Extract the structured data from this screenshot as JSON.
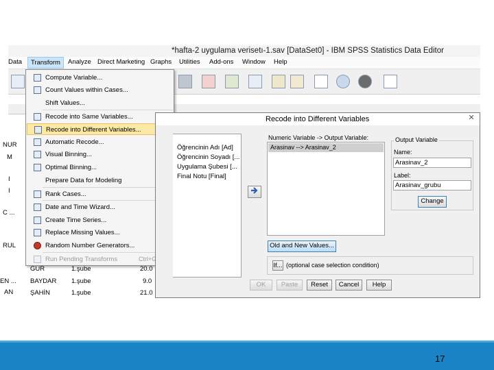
{
  "window": {
    "title": "*hafta-2 uygulama verisetı-1.sav [DataSet0] - IBM SPSS Statistics Data Editor"
  },
  "menubar": {
    "items": [
      "Data",
      "Transform",
      "Analyze",
      "Direct Marketing",
      "Graphs",
      "Utilities",
      "Add-ons",
      "Window",
      "Help"
    ]
  },
  "transform_menu": {
    "items": [
      {
        "label": "Compute Variable..."
      },
      {
        "label": "Count Values within Cases..."
      },
      {
        "label": "Shift Values..."
      },
      {
        "label": "Recode into Same Variables..."
      },
      {
        "label": "Recode into Different Variables..."
      },
      {
        "label": "Automatic Recode..."
      },
      {
        "label": "Visual Binning..."
      },
      {
        "label": "Optimal Binning..."
      },
      {
        "label": "Prepare Data for Modeling"
      },
      {
        "label": "Rank Cases..."
      },
      {
        "label": "Date and Time Wizard..."
      },
      {
        "label": "Create Time Series..."
      },
      {
        "label": "Replace Missing Values..."
      },
      {
        "label": "Random Number Generators..."
      },
      {
        "label": "Run Pending Transforms",
        "shortcut": "Ctrl+G"
      }
    ],
    "highlighted": "Recode into Different Variables..."
  },
  "grid": {
    "left_labels": [
      "NUR",
      "M",
      "I",
      "I",
      "C ...",
      "RUL",
      "EN ...",
      "AN"
    ],
    "rows": [
      {
        "name": "GÜR",
        "group": "1.şube",
        "value": "20.0"
      },
      {
        "name": "BAYDAR",
        "group": "1.şube",
        "value": "9.0"
      },
      {
        "name": "ŞAHİN",
        "group": "1.şube",
        "value": "21.0"
      }
    ]
  },
  "dialog": {
    "title": "Recode into Different Variables",
    "source_variables": [
      "Öğrencinin Adı [Ad]",
      "Öğrencinin Soyadı [...",
      "Uygulama Şubesi [...",
      "Final Notu [Final]"
    ],
    "mapping_label": "Numeric Variable -> Output Variable:",
    "mapping_items": [
      "Arasinav --> Arasinav_2"
    ],
    "output_group_label": "Output Variable",
    "name_label": "Name:",
    "name_value": "Arasinav_2",
    "label_label": "Label:",
    "label_value": "Arasinav_grubu",
    "change_button": "Change",
    "old_new_button": "Old and New Values...",
    "if_button": "If...",
    "if_hint": "(optional case selection condition)",
    "buttons": {
      "ok": "OK",
      "paste": "Paste",
      "reset": "Reset",
      "cancel": "Cancel",
      "help": "Help"
    }
  },
  "footer": {
    "page_number": "17",
    "color": "#1b84c6"
  }
}
